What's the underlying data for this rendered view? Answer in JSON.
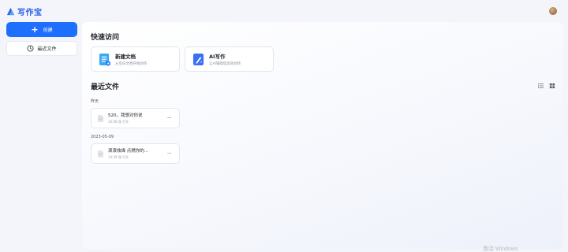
{
  "app": {
    "name": "写作宝"
  },
  "sidebar": {
    "create_label": "创建",
    "recent_label": "最近文件"
  },
  "quick_access": {
    "title": "快速访问",
    "cards": [
      {
        "title": "新建文档",
        "subtitle": "从空白文档开始创作",
        "icon": "new-document-icon"
      },
      {
        "title": "AI写作",
        "subtitle": "让AI辅助您高效创作",
        "icon": "ai-pen-icon"
      }
    ]
  },
  "recent": {
    "title": "最近文件",
    "groups": [
      {
        "date": "昨天",
        "files": [
          {
            "title": "520，我想对你说",
            "meta": "10:08 我 打开"
          }
        ]
      },
      {
        "date": "2023-05-09",
        "files": [
          {
            "title": "滚滚烛烽 点燃你的...",
            "meta": "14:39 我 打开"
          }
        ]
      }
    ],
    "more_label": "···"
  },
  "watermark": "激活 Windows",
  "colors": {
    "accent": "#1f6fff",
    "logo": "#2a5fe8",
    "background": "#f3f5fb"
  }
}
